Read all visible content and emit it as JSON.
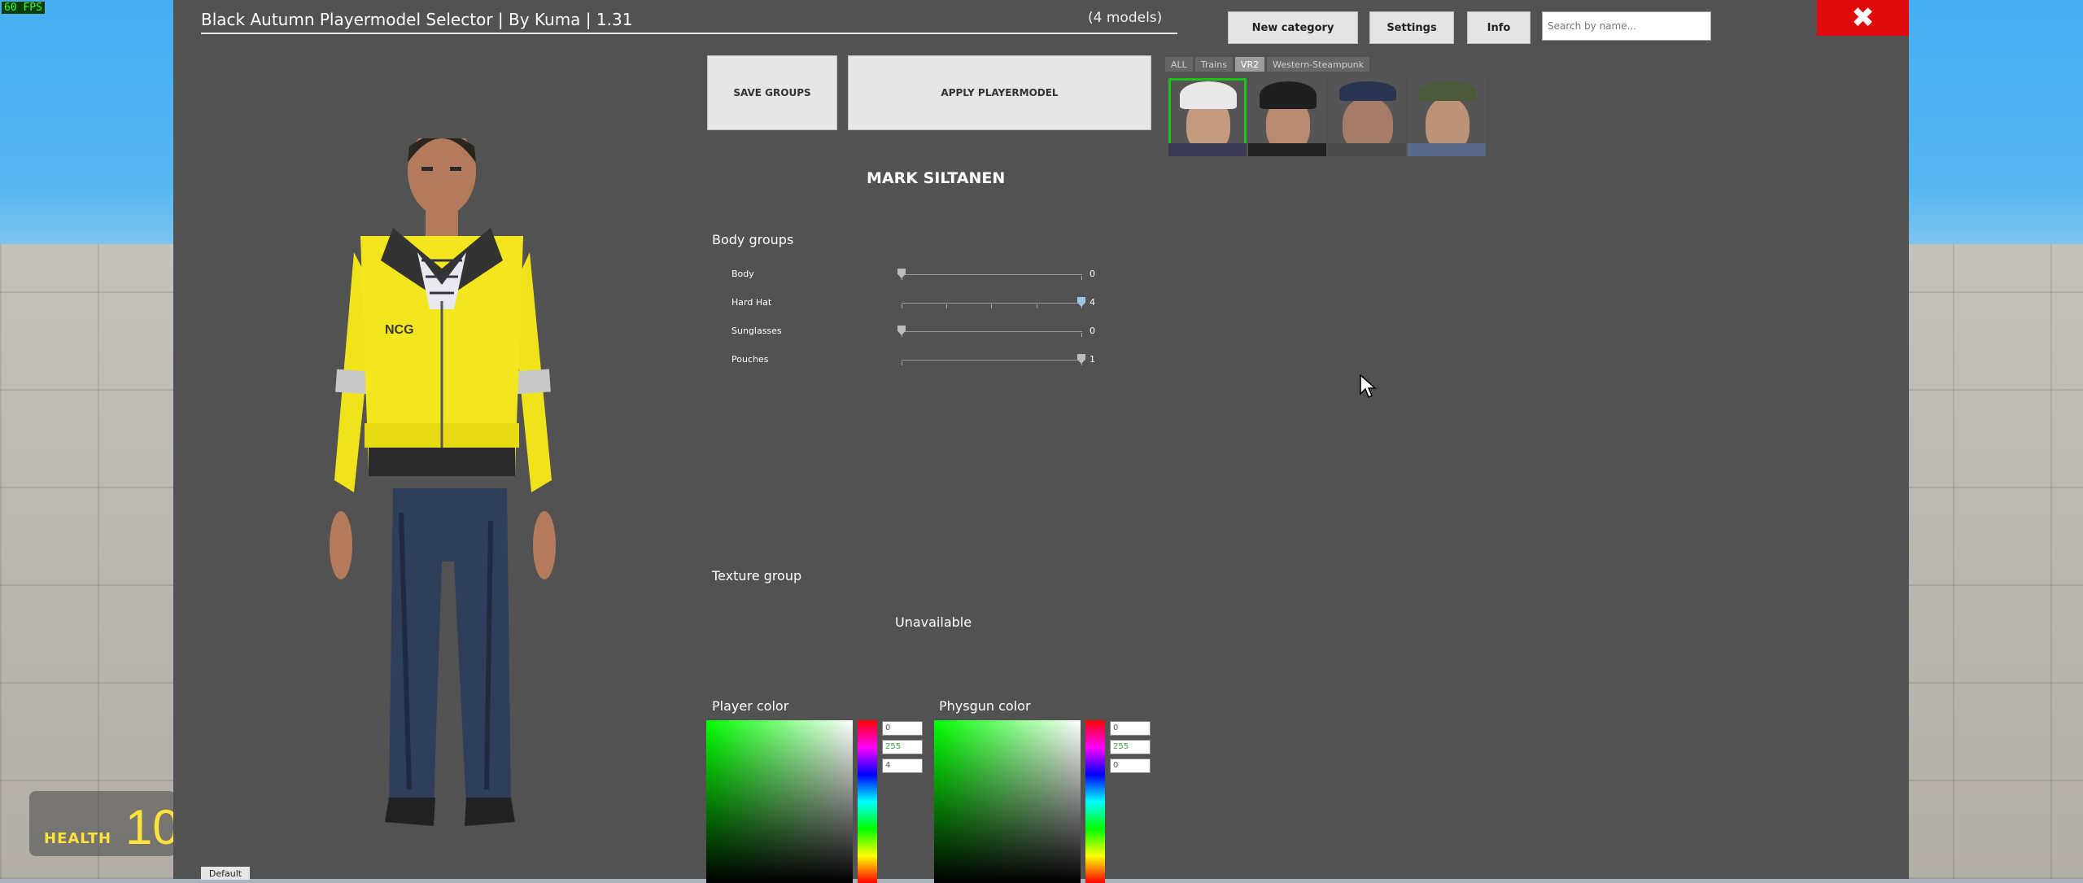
{
  "hud": {
    "fps": "60 FPS",
    "health_label": "HEALTH",
    "health_value": "10"
  },
  "window": {
    "title": "Black Autumn Playermodel Selector | By Kuma | 1.31",
    "model_count": "(4 models)",
    "buttons": {
      "new_category": "New category",
      "settings": "Settings",
      "info": "Info"
    },
    "search_placeholder": "Search by name...",
    "close_icon": "close-icon"
  },
  "actions": {
    "save_groups": "SAVE GROUPS",
    "apply_playermodel": "APPLY PLAYERMODEL"
  },
  "categories": [
    {
      "label": "ALL",
      "active": false
    },
    {
      "label": "Trains",
      "active": false
    },
    {
      "label": "VR2",
      "active": true
    },
    {
      "label": "Western-Steampunk",
      "active": false
    }
  ],
  "selected_model": "MARK SILTANEN",
  "body_groups": {
    "heading": "Body groups",
    "items": [
      {
        "label": "Body",
        "value": "0",
        "fraction": 0.0
      },
      {
        "label": "Hard Hat",
        "value": "4",
        "fraction": 1.0
      },
      {
        "label": "Sunglasses",
        "value": "0",
        "fraction": 0.0
      },
      {
        "label": "Pouches",
        "value": "1",
        "fraction": 1.0
      }
    ]
  },
  "texture_group": {
    "heading": "Texture group",
    "status": "Unavailable"
  },
  "player_color": {
    "heading": "Player color",
    "r": "0",
    "g": "255",
    "b": "4"
  },
  "physgun_color": {
    "heading": "Physgun color",
    "r": "0",
    "g": "255",
    "b": "0"
  },
  "default_button": "Default"
}
